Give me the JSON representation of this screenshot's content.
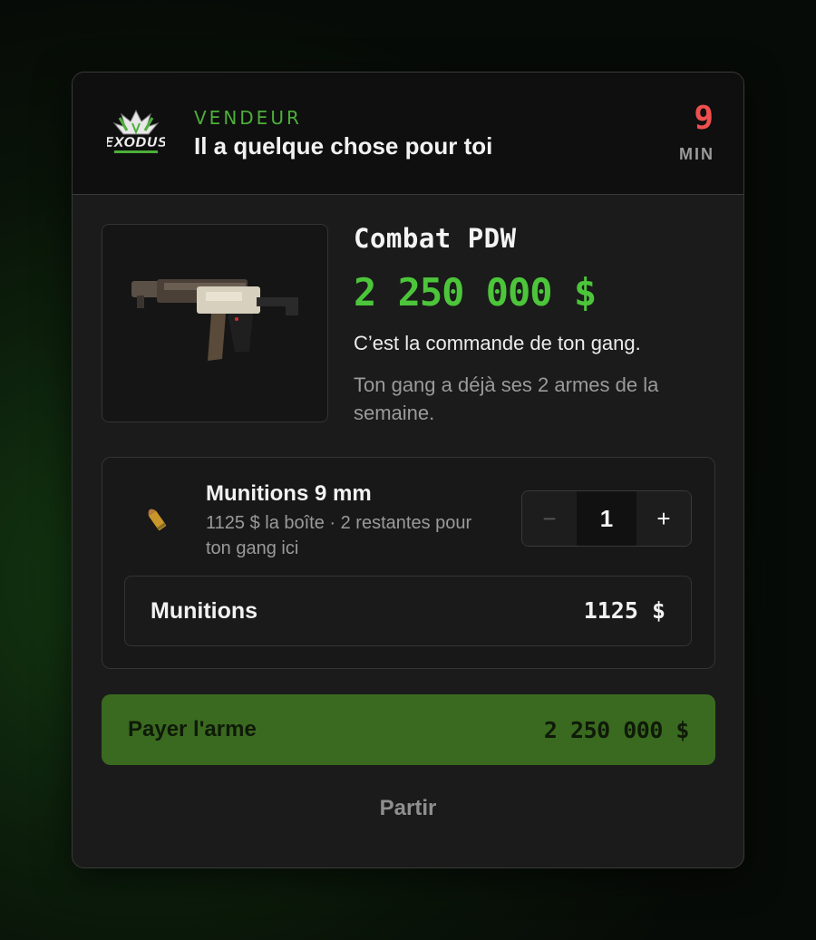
{
  "header": {
    "logo_text": "EXODUS",
    "vendor_label": "VENDEUR",
    "vendor_message": "Il a quelque chose pour toi",
    "timer_value": "9",
    "timer_unit": "MIN"
  },
  "product": {
    "name": "Combat PDW",
    "price": "2 250 000 $",
    "description": "C’est la commande de ton gang.",
    "note": "Ton gang a déjà ses 2 armes de la semaine."
  },
  "ammo": {
    "title": "Munitions 9 mm",
    "subtitle": "1125 $ la boîte · 2 restantes pour ton gang ici",
    "quantity": "1",
    "minus_label": "−",
    "plus_label": "+",
    "total_label": "Munitions",
    "total_value": "1125 $"
  },
  "actions": {
    "pay_label": "Payer l'arme",
    "pay_amount": "2 250 000 $",
    "leave_label": "Partir"
  },
  "colors": {
    "accent_green": "#4cc53a",
    "timer_red": "#ef4f4f",
    "pay_button": "#3a6a1f"
  }
}
